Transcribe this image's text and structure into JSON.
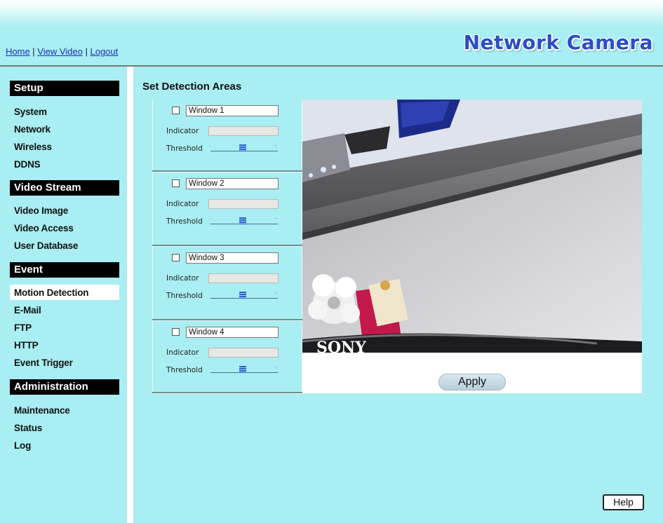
{
  "header": {
    "links": [
      "Home",
      "View Video",
      "Logout"
    ],
    "separator": " | ",
    "brand": "Network Camera"
  },
  "sidebar": {
    "sections": [
      {
        "title": "Setup",
        "items": [
          "System",
          "Network",
          "Wireless",
          "DDNS"
        ]
      },
      {
        "title": "Video Stream",
        "items": [
          "Video Image",
          "Video Access",
          "User Database"
        ]
      },
      {
        "title": "Event",
        "items": [
          "Motion Detection",
          "E-Mail",
          "FTP",
          "HTTP",
          "Event Trigger"
        ]
      },
      {
        "title": "Administration",
        "items": [
          "Maintenance",
          "Status",
          "Log"
        ]
      }
    ],
    "active_item": "Motion Detection"
  },
  "main": {
    "title": "Set Detection Areas",
    "indicator_label": "Indicator",
    "threshold_label": "Threshold",
    "slider_minus": "-",
    "slider_plus": "+",
    "windows": [
      {
        "name": "Window 1",
        "checked": false
      },
      {
        "name": "Window 2",
        "checked": false
      },
      {
        "name": "Window 3",
        "checked": false
      },
      {
        "name": "Window 4",
        "checked": false
      }
    ],
    "threshold_level": 0.5,
    "camera_text": "SONY",
    "apply_label": "Apply",
    "help_label": "Help"
  },
  "colors": {
    "background": "#a8eef2",
    "link": "#1a2fbf",
    "brand": "#2a4ec4",
    "section_header": "#000000"
  }
}
